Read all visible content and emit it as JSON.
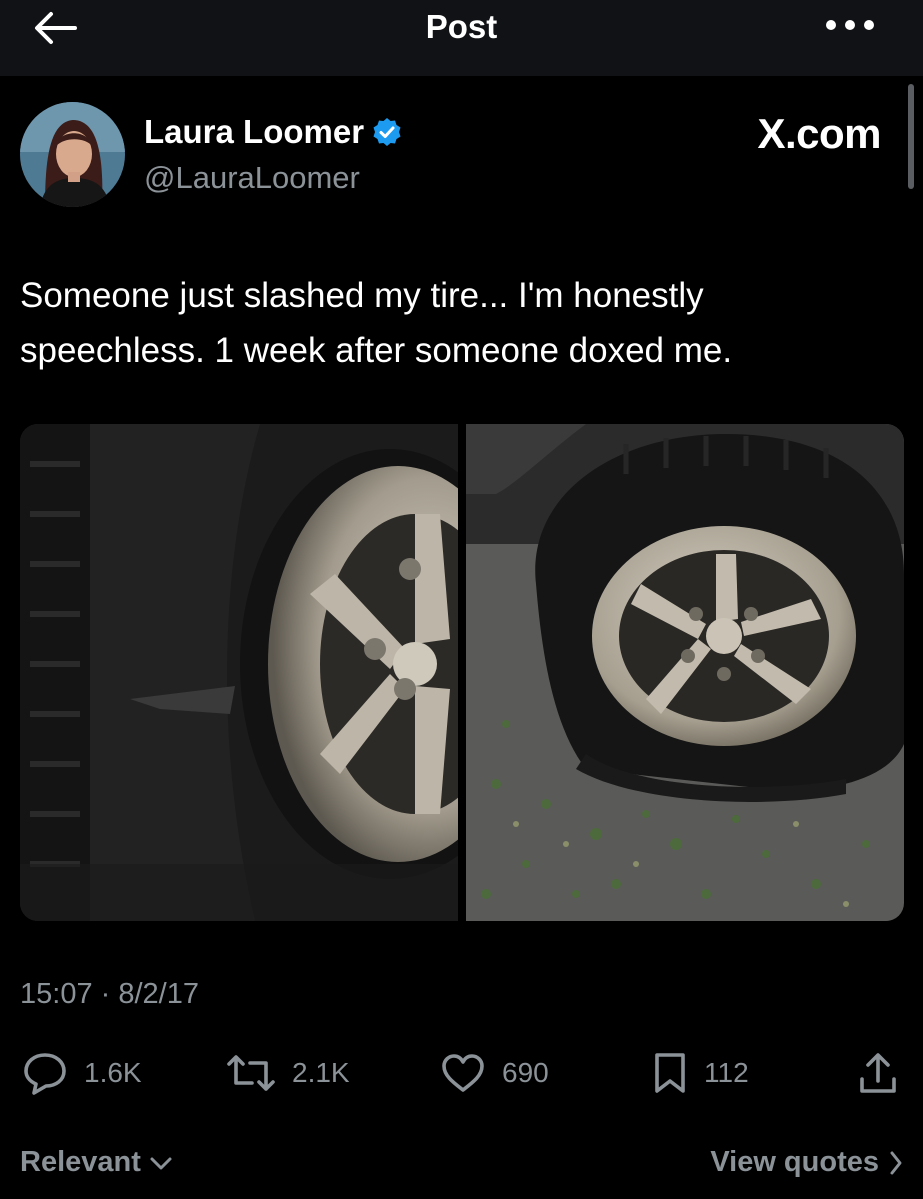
{
  "header": {
    "title": "Post",
    "back_icon": "back-arrow-icon",
    "more_icon": "more-horizontal-icon"
  },
  "author": {
    "display_name": "Laura Loomer",
    "handle": "@LauraLoomer",
    "verified": true,
    "verified_color": "#1d9bf0"
  },
  "watermark": "X.com",
  "post": {
    "text": "Someone just slashed my tire... I'm honestly speechless. 1 week after someone doxed me.",
    "timestamp": "15:07 · 8/2/17"
  },
  "media": [
    {
      "alt": "close-up of slashed tire on alloy wheel"
    },
    {
      "alt": "flat tire on alloy wheel parked on asphalt with leaves"
    }
  ],
  "actions": {
    "replies": "1.6K",
    "reposts": "2.1K",
    "likes": "690",
    "bookmarks": "112"
  },
  "footer": {
    "sort_label": "Relevant",
    "quotes_label": "View quotes"
  },
  "colors": {
    "background": "#000000",
    "topbar": "#111215",
    "text_primary": "#e7e9ea",
    "text_secondary": "#8b9298",
    "verified": "#1d9bf0"
  }
}
